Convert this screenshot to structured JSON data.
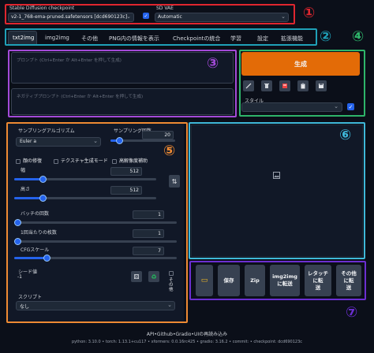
{
  "header": {
    "checkpoint_label": "Stable Diffusion checkpoint",
    "checkpoint_value": "v2-1_768-ema-pruned.safetensors [dcd690123c]",
    "vae_label": "SD VAE",
    "vae_value": "Automatic"
  },
  "tabs": [
    "txt2img",
    "img2img",
    "その他",
    "PNG内の情報を表示",
    "Checkpointの統合",
    "学習",
    "設定",
    "拡張機能"
  ],
  "prompt": {
    "positive_placeholder": "プロンプト (Ctrl+Enter か Alt+Enter を押して生成)",
    "negative_placeholder": "ネガティブプロンプト (Ctrl+Enter か Alt+Enter を押して生成)"
  },
  "generate": {
    "label": "生成",
    "style_label": "スタイル"
  },
  "settings": {
    "sampler_label": "サンプリングアルゴリズム",
    "sampler_value": "Euler a",
    "steps_label": "サンプリング回数",
    "steps_value": "20",
    "steps_fraction": 0.13,
    "restore_faces": "顔の修復",
    "tiling": "テクスチャ生成モード",
    "hires_fix": "高解像度補助",
    "width_label": "幅",
    "width_value": "512",
    "width_fraction": 0.2,
    "height_label": "高さ",
    "height_value": "512",
    "height_fraction": 0.2,
    "batch_count_label": "バッチの回数",
    "batch_count_value": "1",
    "batch_count_fraction": 0.0,
    "batch_size_label": "1回当たりの枚数",
    "batch_size_value": "1",
    "batch_size_fraction": 0.0,
    "cfg_label": "CFGスケール",
    "cfg_value": "7",
    "cfg_fraction": 0.2,
    "seed_label": "シード値",
    "seed_value": "-1",
    "extra_label": "その他",
    "script_label": "スクリプト",
    "script_value": "なし"
  },
  "actions": [
    "保存",
    "Zip",
    "img2img\nに転送",
    "レタッチ\nに転\n送",
    "その他\nに転\n送"
  ],
  "footer": {
    "links": "API•Github•Gradio•UIの再読み込み",
    "versions": "python: 3.10.0  •  torch: 1.13.1+cu117  •  xformers: 0.0.16rc425  •  gradio: 3.16.2  •  commit:  •  checkpoint: dcd690123c"
  },
  "annotations": [
    "①",
    "②",
    "③",
    "④",
    "⑤",
    "⑥",
    "⑦"
  ],
  "colors": {
    "red": "#e0262f",
    "teal": "#1fa1b8",
    "violet": "#a34ad8",
    "green": "#2eb56a",
    "orange": "#ee8a33",
    "sky": "#3fb8d8",
    "purple": "#6b2fd1",
    "generate_orange": "#e36b07",
    "accent_blue": "#2563eb"
  }
}
